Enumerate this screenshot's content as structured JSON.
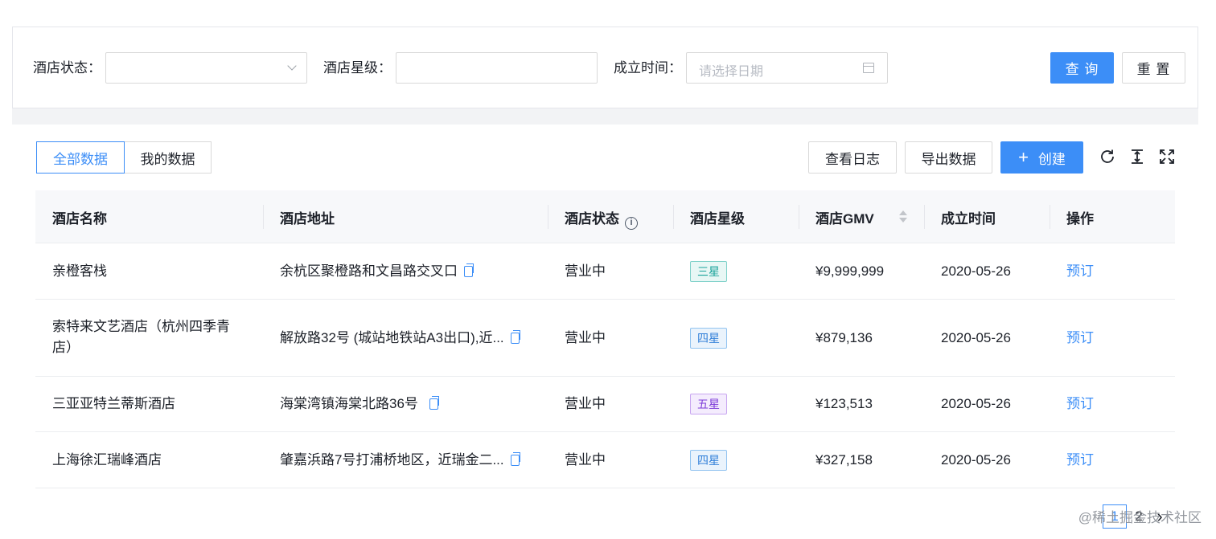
{
  "filters": {
    "status_label": "酒店状态：",
    "stars_label": "酒店星级：",
    "date_label": "成立时间：",
    "date_placeholder": "请选择日期",
    "search_button": "查 询",
    "reset_button": "重 置"
  },
  "toolbar": {
    "tab_all": "全部数据",
    "tab_mine": "我的数据",
    "view_log": "查看日志",
    "export": "导出数据",
    "create_plus": "+",
    "create": "创建",
    "icons": [
      "refresh-icon",
      "column-height-icon",
      "fullscreen-icon"
    ]
  },
  "table": {
    "columns": [
      "酒店名称",
      "酒店地址",
      "酒店状态",
      "酒店星级",
      "酒店GMV",
      "成立时间",
      "操作"
    ],
    "rows": [
      {
        "name": "亲橙客栈",
        "address": "余杭区聚橙路和文昌路交叉口",
        "status": "营业中",
        "stars": "三星",
        "gmv": "¥9,999,999",
        "date": "2020-05-26",
        "action": "预订"
      },
      {
        "name": "索特来文艺酒店（杭州四季青店）",
        "address": "解放路32号 (城站地铁站A3出口),近...",
        "status": "营业中",
        "stars": "四星",
        "gmv": "¥879,136",
        "date": "2020-05-26",
        "action": "预订"
      },
      {
        "name": "三亚亚特兰蒂斯酒店",
        "address": "海棠湾镇海棠北路36号",
        "status": "营业中",
        "stars": "五星",
        "gmv": "¥123,513",
        "date": "2020-05-26",
        "action": "预订"
      },
      {
        "name": "上海徐汇瑞峰酒店",
        "address": "肇嘉浜路7号打浦桥地区，近瑞金二...",
        "status": "营业中",
        "stars": "四星",
        "gmv": "¥327,158",
        "date": "2020-05-26",
        "action": "预订"
      }
    ]
  },
  "pagination": {
    "page1": "1",
    "page2": "2",
    "next": "›"
  },
  "watermark": "@稀土掘金技术社区",
  "colors": {
    "primary": "#3c8ef7",
    "header_bg": "#f7f8fa"
  }
}
